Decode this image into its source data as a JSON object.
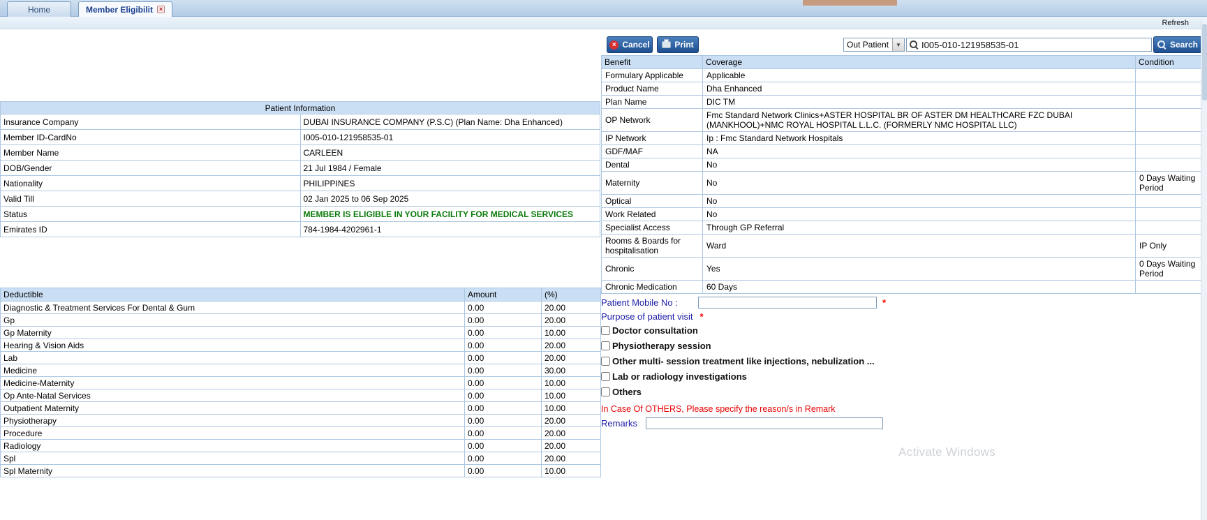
{
  "tabs": {
    "home": "Home",
    "active": "Member Eligibilit"
  },
  "refresh_label": "Refresh",
  "patient_info": {
    "title": "Patient Information",
    "rows": [
      {
        "label": "Insurance Company",
        "value": "DUBAI INSURANCE COMPANY (P.S.C) (Plan Name: Dha Enhanced)"
      },
      {
        "label": "Member ID-CardNo",
        "value": "I005-010-121958535-01"
      },
      {
        "label": "Member Name",
        "value": "CARLEEN"
      },
      {
        "label": "DOB/Gender",
        "value": "21 Jul 1984 / Female"
      },
      {
        "label": "Nationality",
        "value": "PHILIPPINES"
      },
      {
        "label": "Valid Till",
        "value": "02 Jan 2025 to 06 Sep 2025"
      },
      {
        "label": "Status",
        "value": "MEMBER IS ELIGIBLE IN YOUR FACILITY FOR MEDICAL SERVICES"
      },
      {
        "label": "Emirates ID",
        "value": "784-1984-4202961-1"
      }
    ]
  },
  "deductibles": {
    "headers": {
      "name": "Deductible",
      "amount": "Amount",
      "pct": "(%)"
    },
    "rows": [
      {
        "name": "Diagnostic & Treatment Services For Dental & Gum",
        "amount": "0.00",
        "pct": "20.00"
      },
      {
        "name": "Gp",
        "amount": "0.00",
        "pct": "20.00"
      },
      {
        "name": "Gp Maternity",
        "amount": "0.00",
        "pct": "10.00"
      },
      {
        "name": "Hearing & Vision Aids",
        "amount": "0.00",
        "pct": "20.00"
      },
      {
        "name": "Lab",
        "amount": "0.00",
        "pct": "20.00"
      },
      {
        "name": "Medicine",
        "amount": "0.00",
        "pct": "30.00"
      },
      {
        "name": "Medicine-Maternity",
        "amount": "0.00",
        "pct": "10.00"
      },
      {
        "name": "Op Ante-Natal Services",
        "amount": "0.00",
        "pct": "10.00"
      },
      {
        "name": "Outpatient Maternity",
        "amount": "0.00",
        "pct": "10.00"
      },
      {
        "name": "Physiotherapy",
        "amount": "0.00",
        "pct": "20.00"
      },
      {
        "name": "Procedure",
        "amount": "0.00",
        "pct": "20.00"
      },
      {
        "name": "Radiology",
        "amount": "0.00",
        "pct": "20.00"
      },
      {
        "name": "Spl",
        "amount": "0.00",
        "pct": "20.00"
      },
      {
        "name": "Spl Maternity",
        "amount": "0.00",
        "pct": "10.00"
      }
    ]
  },
  "toolbar": {
    "cancel_label": "Cancel",
    "print_label": "Print",
    "patient_type": "Out Patient",
    "search_value": "I005-010-121958535-01",
    "search_label": "Search"
  },
  "benefits": {
    "headers": {
      "benefit": "Benefit",
      "coverage": "Coverage",
      "condition": "Condition"
    },
    "rows": [
      {
        "benefit": "Formulary Applicable",
        "coverage": "Applicable",
        "condition": ""
      },
      {
        "benefit": "Product Name",
        "coverage": "Dha Enhanced",
        "condition": ""
      },
      {
        "benefit": "Plan Name",
        "coverage": "DIC TM",
        "condition": ""
      },
      {
        "benefit": "OP Network",
        "coverage": "Fmc Standard Network Clinics+ASTER HOSPITAL BR OF ASTER DM HEALTHCARE FZC DUBAI (MANKHOOL)+NMC ROYAL HOSPITAL L.L.C. (FORMERLY NMC HOSPITAL LLC)",
        "condition": ""
      },
      {
        "benefit": "IP Network",
        "coverage": "Ip : Fmc Standard Network Hospitals",
        "condition": ""
      },
      {
        "benefit": "GDF/MAF",
        "coverage": "NA",
        "condition": ""
      },
      {
        "benefit": "Dental",
        "coverage": "No",
        "condition": ""
      },
      {
        "benefit": "Maternity",
        "coverage": "No",
        "condition": "0 Days Waiting Period"
      },
      {
        "benefit": "Optical",
        "coverage": "No",
        "condition": ""
      },
      {
        "benefit": "Work Related",
        "coverage": "No",
        "condition": ""
      },
      {
        "benefit": "Specialist Access",
        "coverage": "Through GP Referral",
        "condition": ""
      },
      {
        "benefit": "Rooms & Boards for hospitalisation",
        "coverage": "Ward",
        "condition": "IP Only"
      },
      {
        "benefit": "Chronic",
        "coverage": "Yes",
        "condition": "0 Days Waiting Period"
      },
      {
        "benefit": "Chronic Medication",
        "coverage": "60 Days",
        "condition": ""
      }
    ]
  },
  "visit_form": {
    "mobile_label": "Patient Mobile No :",
    "required_marker": "*",
    "purpose_label": "Purpose of patient visit",
    "options": [
      "Doctor consultation",
      "Physiotherapy session",
      "Other multi- session treatment like injections, nebulization ...",
      "Lab or radiology investigations",
      "Others"
    ],
    "others_note": "In Case Of OTHERS, Please specify the reason/s in Remark",
    "remarks_label": "Remarks"
  },
  "watermark": "Activate Windows"
}
